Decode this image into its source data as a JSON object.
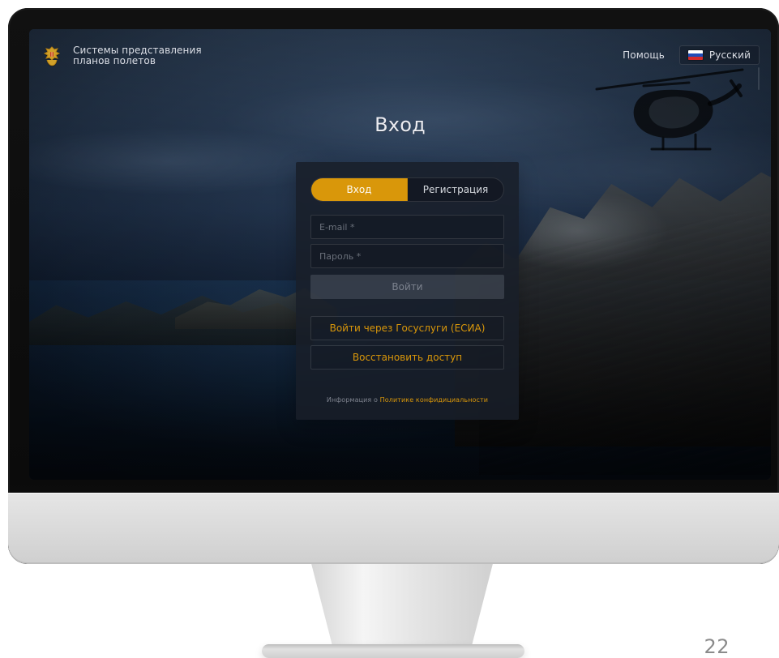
{
  "header": {
    "brand_lines": [
      "Системы представления",
      "планов полетов"
    ],
    "help_label": "Помощь",
    "language_label": "Русский"
  },
  "main": {
    "title": "Вход",
    "tabs": [
      {
        "label": "Вход",
        "active": true
      },
      {
        "label": "Регистрация",
        "active": false
      }
    ],
    "email_placeholder": "E-mail *",
    "password_placeholder": "Пароль *",
    "login_button_label": "Войти",
    "gosuslugi_button_label": "Войти через Госуслуги (ЕСИА)",
    "restore_button_label": "Восстановить доступ",
    "privacy_prefix": "Информация о",
    "privacy_link_label": "Политике конфидициальности"
  },
  "footer": {
    "page_number": "22"
  },
  "icons": {
    "emblem": "coat-of-arms-icon",
    "language_flag": "russia-flag-icon",
    "helicopter": "helicopter-icon"
  },
  "colors": {
    "accent": "#d9970a",
    "card_bg": "#191e29",
    "text_primary": "#ebeef4",
    "text_muted": "#d2d6e0"
  }
}
